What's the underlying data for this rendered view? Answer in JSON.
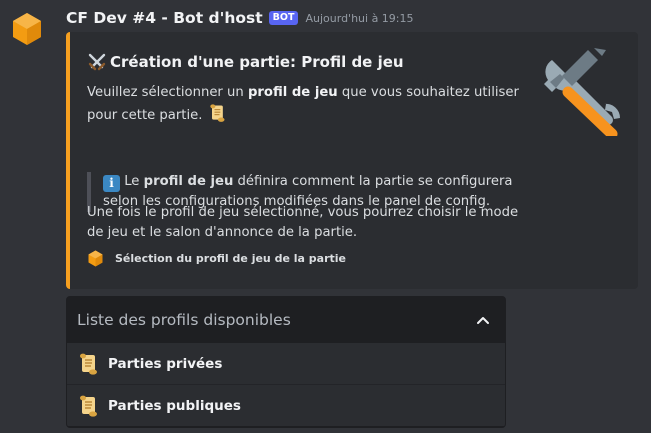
{
  "message": {
    "author": "CF Dev #4 - Bot d'host",
    "bot_tag": "BOT",
    "timestamp": "Aujourd'hui à 19:15",
    "avatar_icon": "orange-hexagon-icon"
  },
  "embed": {
    "accent_color": "#f7a020",
    "title_icon": "crossed-swords-icon",
    "title": "Création d'une partie: Profil de jeu",
    "desc1_before": "Veuillez sélectionner un ",
    "desc1_bold": "profil de jeu",
    "desc1_after": " que vous souhaitez utiliser pour cette partie. ",
    "quote_before": " Le ",
    "quote_bold": "profil de jeu",
    "quote_after": " définira comment la partie se configurera selon les configurations modifiées dans le panel de config.",
    "desc2": "Une fois le profil de jeu sélectionné, vous pourrez choisir le mode de jeu et le salon d'annonce de la partie.",
    "thumbnail_icon": "hammer-and-wrench-icon",
    "footer_icon": "orange-hexagon-icon",
    "footer_text": "Sélection du profil de jeu de la partie"
  },
  "select_menu": {
    "placeholder": "Liste des profils disponibles",
    "expanded": true,
    "options": [
      {
        "label": "Parties privées",
        "icon": "scroll-icon"
      },
      {
        "label": "Parties publiques",
        "icon": "scroll-icon"
      }
    ]
  }
}
